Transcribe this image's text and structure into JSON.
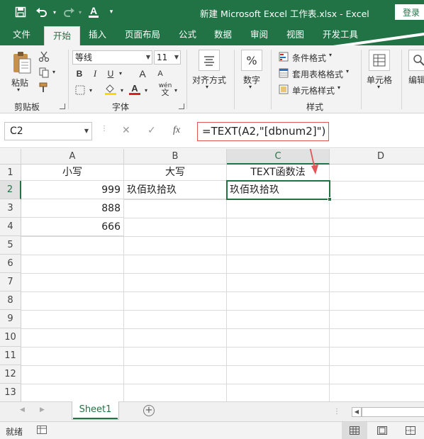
{
  "titlebar": {
    "title": "新建 Microsoft Excel 工作表.xlsx  -  Excel",
    "login": "登录",
    "quick_access": {
      "save_icon": "save-icon",
      "undo_icon": "undo-icon",
      "redo_icon": "redo-icon",
      "font_color_icon": "font-color-icon",
      "customize_icon": "customize-qat-icon"
    }
  },
  "ribbon": {
    "tabs": [
      {
        "label": "文件"
      },
      {
        "label": "开始"
      },
      {
        "label": "插入"
      },
      {
        "label": "页面布局"
      },
      {
        "label": "公式"
      },
      {
        "label": "数据"
      },
      {
        "label": "审阅"
      },
      {
        "label": "视图"
      },
      {
        "label": "开发工具"
      }
    ],
    "active_tab": "开始",
    "clipboard": {
      "paste_label": "粘贴",
      "group_label": "剪贴板"
    },
    "font": {
      "font_name": "等线",
      "font_size": "11",
      "group_label": "字体",
      "bold": "B",
      "italic": "I",
      "underline": "U",
      "grow": "A",
      "shrink": "A",
      "wen": "wén"
    },
    "alignment": {
      "label": "对齐方式"
    },
    "number": {
      "label": "数字",
      "symbol": "%"
    },
    "styles": {
      "conditional_format": "条件格式",
      "table_format": "套用表格格式",
      "cell_style": "单元格样式",
      "group_label": "样式"
    },
    "cells": {
      "label": "单元格"
    },
    "editing": {
      "label": "编辑"
    }
  },
  "formula_bar": {
    "name_box": "C2",
    "cancel_symbol": "✕",
    "enter_symbol": "✓",
    "fx_symbol": "fx",
    "formula": "=TEXT(A2,\"[dbnum2]\")"
  },
  "grid": {
    "columns": [
      "A",
      "B",
      "C",
      "D"
    ],
    "rows": [
      "1",
      "2",
      "3",
      "4",
      "5",
      "6",
      "7",
      "8",
      "9",
      "10",
      "11",
      "12",
      "13"
    ],
    "cells": {
      "A1": "小写",
      "B1": "大写",
      "C1": "TEXT函数法",
      "A2": "999",
      "B2": "玖佰玖拾玖",
      "C2": "玖佰玖拾玖",
      "A3": "888",
      "A4": "666"
    },
    "selected_cell": "C2"
  },
  "sheets": {
    "tabs": [
      "Sheet1"
    ],
    "add_symbol": "+"
  },
  "statusbar": {
    "status": "就绪"
  },
  "colors": {
    "excel_green": "#217346",
    "annotation_red": "#e15656"
  }
}
